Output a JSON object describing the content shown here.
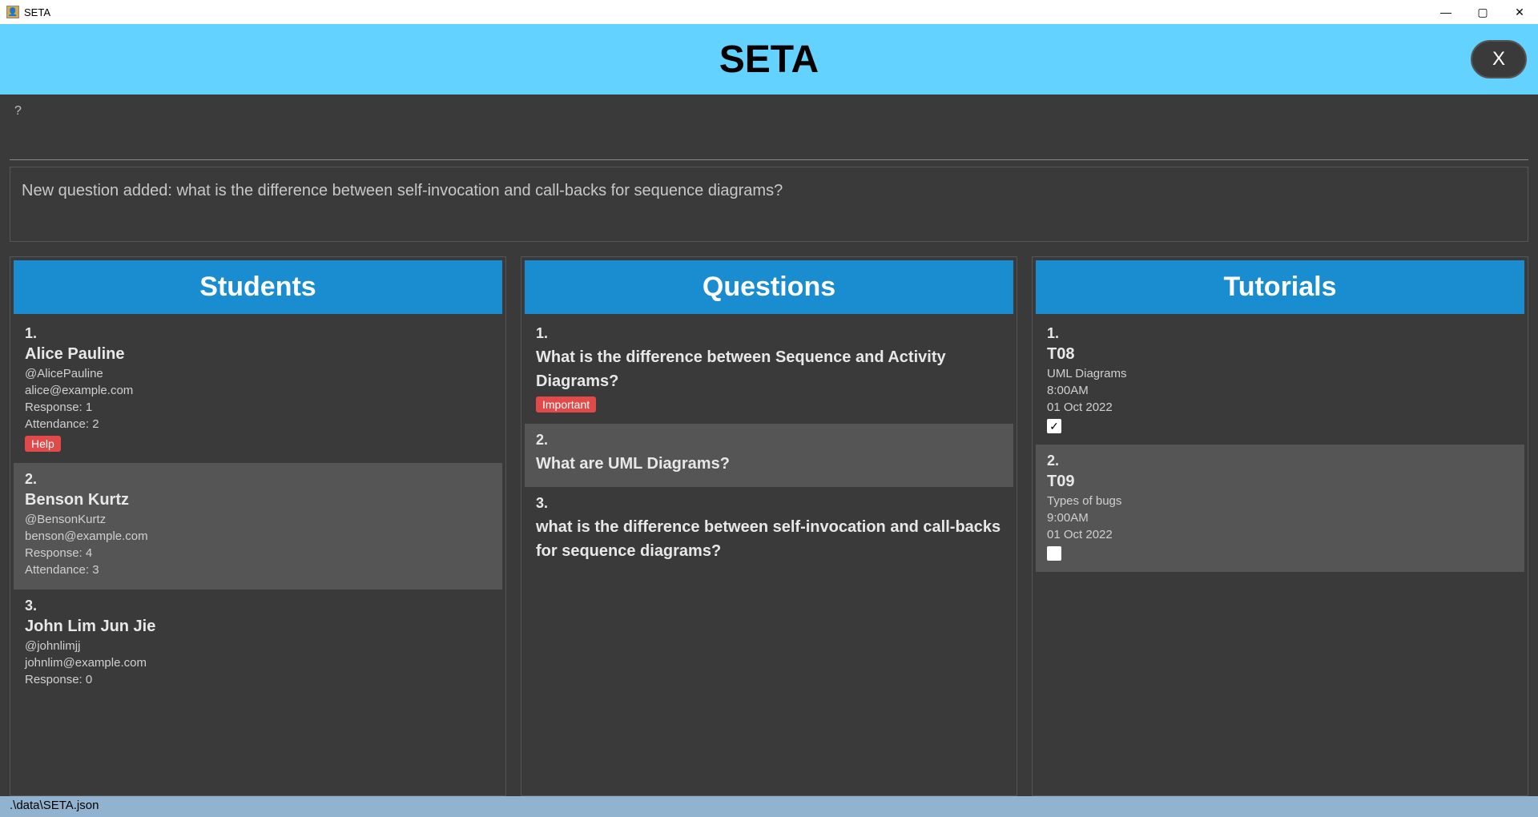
{
  "window": {
    "title": "SETA"
  },
  "header": {
    "title": "SETA",
    "close_label": "X"
  },
  "help_mark": "?",
  "message": "New question added: what is the difference between self-invocation and call-backs for sequence diagrams?",
  "columns": {
    "students": {
      "header": "Students",
      "items": [
        {
          "index": "1.",
          "name": "Alice Pauline",
          "handle": "@AlicePauline",
          "email": "alice@example.com",
          "response": "Response: 1",
          "attendance": "Attendance: 2",
          "tag": "Help",
          "alt": false
        },
        {
          "index": "2.",
          "name": "Benson Kurtz",
          "handle": "@BensonKurtz",
          "email": "benson@example.com",
          "response": "Response: 4",
          "attendance": "Attendance: 3",
          "tag": "",
          "alt": true
        },
        {
          "index": "3.",
          "name": "John Lim Jun Jie",
          "handle": "@johnlimjj",
          "email": "johnlim@example.com",
          "response": "Response: 0",
          "attendance": "",
          "tag": "",
          "alt": false
        }
      ]
    },
    "questions": {
      "header": "Questions",
      "items": [
        {
          "index": "1.",
          "text": "What is the difference between Sequence and Activity Diagrams?",
          "tag": "Important",
          "alt": false
        },
        {
          "index": "2.",
          "text": "What are UML Diagrams?",
          "tag": "",
          "alt": true
        },
        {
          "index": "3.",
          "text": "what is the difference between self-invocation and call-backs for sequence diagrams?",
          "tag": "",
          "alt": false
        }
      ]
    },
    "tutorials": {
      "header": "Tutorials",
      "items": [
        {
          "index": "1.",
          "code": "T08",
          "topic": "UML Diagrams",
          "time": "8:00AM",
          "date": "01 Oct 2022",
          "checked": true,
          "alt": false
        },
        {
          "index": "2.",
          "code": "T09",
          "topic": "Types of bugs",
          "time": "9:00AM",
          "date": "01 Oct 2022",
          "checked": false,
          "alt": true
        }
      ]
    }
  },
  "footer": ".\\data\\SETA.json"
}
